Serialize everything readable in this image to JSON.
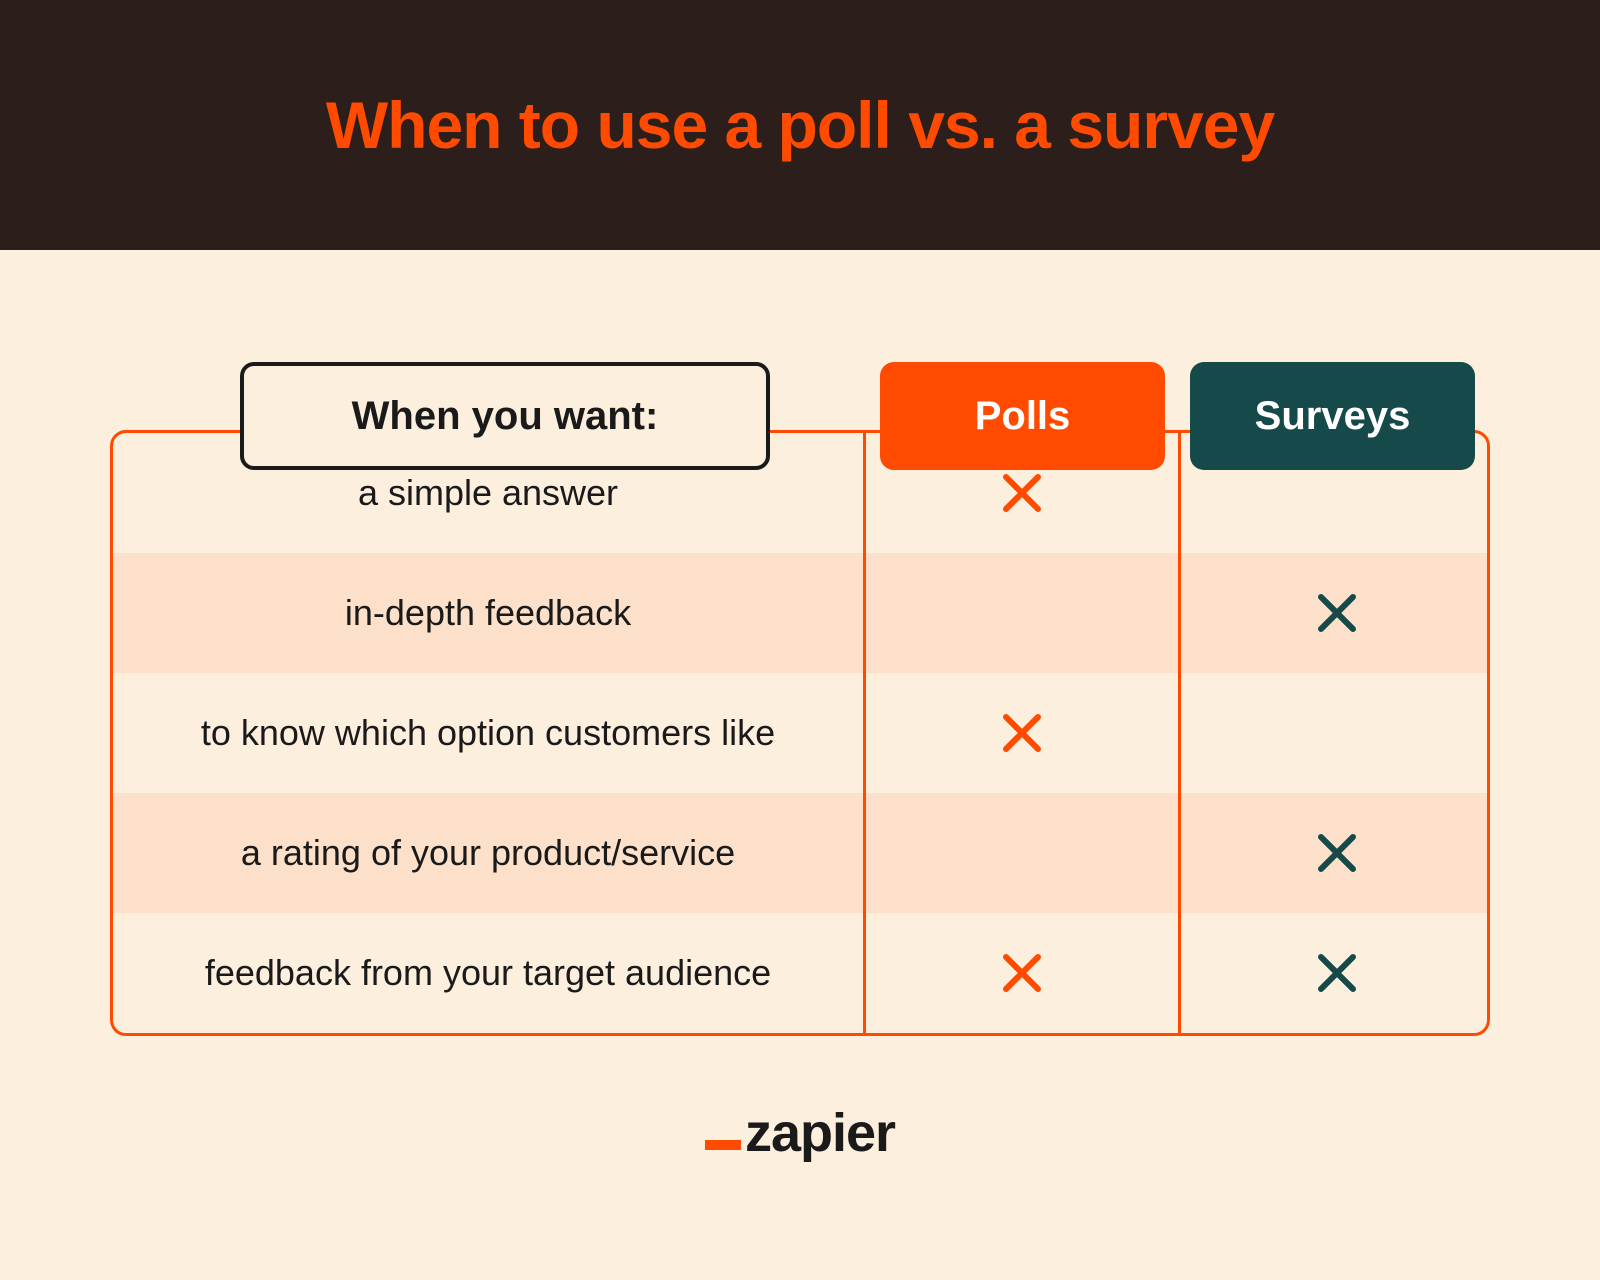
{
  "title": "When to use a poll vs. a survey",
  "headers": {
    "want": "When you want:",
    "polls": "Polls",
    "surveys": "Surveys"
  },
  "rows": [
    {
      "label": "a simple answer",
      "polls": true,
      "surveys": false
    },
    {
      "label": "in-depth feedback",
      "polls": false,
      "surveys": true
    },
    {
      "label": "to know which option customers like",
      "polls": true,
      "surveys": false
    },
    {
      "label": "a rating of your product/service",
      "polls": false,
      "surveys": true
    },
    {
      "label": "feedback from your target audience",
      "polls": true,
      "surveys": true
    }
  ],
  "logo": "zapier",
  "colors": {
    "accent": "#ff4a00",
    "teal": "#15494a",
    "header_bg": "#2c1e1a",
    "page_bg": "#fdefdd",
    "row_alt": "#fce0ca"
  },
  "chart_data": {
    "type": "table",
    "title": "When to use a poll vs. a survey",
    "columns": [
      "When you want:",
      "Polls",
      "Surveys"
    ],
    "rows": [
      [
        "a simple answer",
        true,
        false
      ],
      [
        "in-depth feedback",
        false,
        true
      ],
      [
        "to know which option customers like",
        true,
        false
      ],
      [
        "a rating of your product/service",
        false,
        true
      ],
      [
        "feedback from your target audience",
        true,
        true
      ]
    ]
  }
}
